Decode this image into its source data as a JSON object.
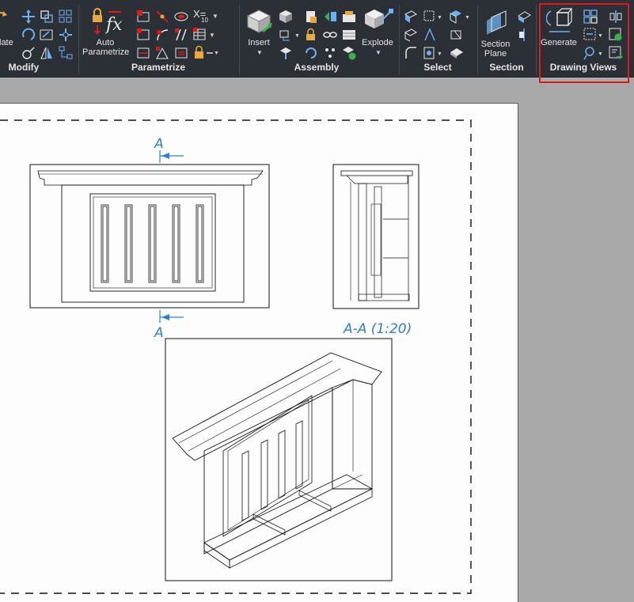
{
  "ribbon": {
    "panels": {
      "modify": "Modify",
      "parametrize": "Parametrize",
      "assembly": "Assembly",
      "select": "Select",
      "section": "Section",
      "drawing_views": "Drawing Views"
    },
    "buttons": {
      "rotate_partial": "late",
      "auto_parametrize_line1": "Auto",
      "auto_parametrize_line2": "Parametrize",
      "insert": "Insert",
      "explode": "Explode",
      "section_plane_line1": "Section",
      "section_plane_line2": "Plane",
      "generate": "Generate"
    },
    "small_icon_text": {
      "x_equals": "X=",
      "subscript_10": "10"
    },
    "colors": {
      "background": "#2b2f36",
      "highlight": "#e0181c",
      "accent": "#3a8ee6"
    }
  },
  "drawing": {
    "section_label_top": "A",
    "section_label_bottom": "A",
    "section_view_title": "A-A (1:20)"
  }
}
